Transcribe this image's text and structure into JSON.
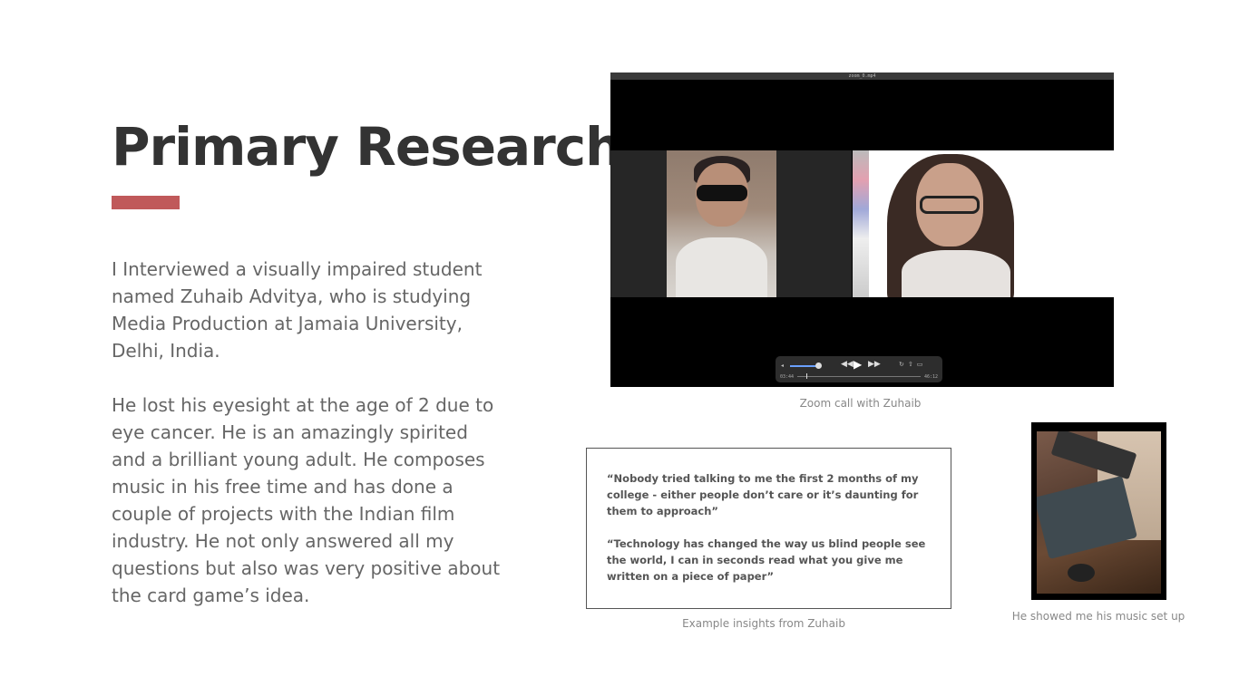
{
  "page": {
    "title": "Primary Research",
    "accent_color": "#c0595a",
    "paragraphs": [
      "I Interviewed a visually impaired student named Zuhaib Advitya, who is studying Media Production at Jamaia University, Delhi, India.",
      "He lost his eyesight at the age of 2 due to eye cancer. He is an amazingly spirited and a brilliant young adult. He composes music in his free time and has done a couple of projects with the Indian film industry. He not only answered all my questions but also was very positive about the card game’s idea."
    ]
  },
  "video": {
    "filename": "zoom_0.mp4",
    "time_elapsed": "03:44",
    "time_remaining": "46:12",
    "caption": "Zoom call with Zuhaib"
  },
  "quotes": {
    "items": [
      "“Nobody tried talking to me the first 2 months of my college - either people don’t care or it’s daunting for them to approach”",
      "“Technology has changed the way us blind people see the world, I can in seconds read what you give me written on a piece of paper”"
    ],
    "caption": "Example insights from Zuhaib"
  },
  "music_photo": {
    "caption": "He showed me his music set up"
  }
}
